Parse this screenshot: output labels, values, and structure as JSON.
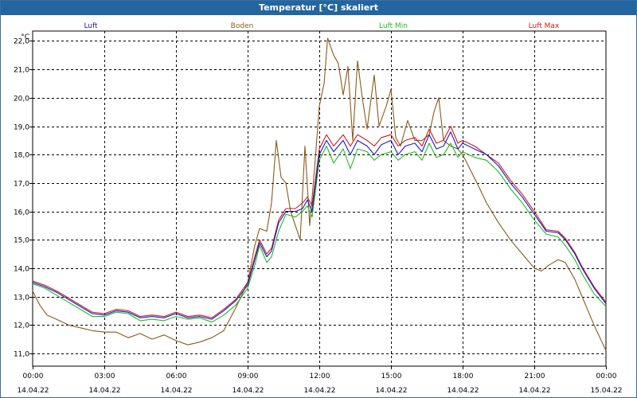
{
  "window": {
    "title": "Temperatur [°C] skaliert"
  },
  "chart_data": {
    "type": "line",
    "title": "Temperatur [°C] skaliert",
    "ylabel": "°C",
    "xlabel": "",
    "ylim": [
      10.55,
      22.35
    ],
    "grid": true,
    "legend_placement": "top",
    "y_ticks": [
      "11,0",
      "12,0",
      "13,0",
      "14,0",
      "15,0",
      "16,0",
      "17,0",
      "18,0",
      "19,0",
      "20,0",
      "21,0",
      "22,0"
    ],
    "x_ticks": [
      {
        "time": "00:00",
        "date": "14.04.22",
        "hour": 0
      },
      {
        "time": "03:00",
        "date": "14.04.22",
        "hour": 3
      },
      {
        "time": "06:00",
        "date": "14.04.22",
        "hour": 6
      },
      {
        "time": "09:00",
        "date": "14.04.22",
        "hour": 9
      },
      {
        "time": "12:00",
        "date": "14.04.22",
        "hour": 12
      },
      {
        "time": "15:00",
        "date": "14.04.22",
        "hour": 15
      },
      {
        "time": "18:00",
        "date": "14.04.22",
        "hour": 18
      },
      {
        "time": "21:00",
        "date": "14.04.22",
        "hour": 21
      },
      {
        "time": "00:00",
        "date": "15.04.22",
        "hour": 24
      }
    ],
    "series": [
      {
        "name": "Luft",
        "color": "#1a1acc",
        "points": [
          [
            0,
            13.5
          ],
          [
            0.5,
            13.35
          ],
          [
            1,
            13.15
          ],
          [
            1.5,
            12.9
          ],
          [
            2,
            12.65
          ],
          [
            2.5,
            12.4
          ],
          [
            3,
            12.35
          ],
          [
            3.5,
            12.5
          ],
          [
            4,
            12.45
          ],
          [
            4.5,
            12.25
          ],
          [
            5,
            12.3
          ],
          [
            5.5,
            12.25
          ],
          [
            6,
            12.4
          ],
          [
            6.5,
            12.25
          ],
          [
            7,
            12.3
          ],
          [
            7.5,
            12.2
          ],
          [
            8,
            12.5
          ],
          [
            8.5,
            12.85
          ],
          [
            9,
            13.4
          ],
          [
            9.3,
            14.3
          ],
          [
            9.5,
            14.9
          ],
          [
            9.8,
            14.4
          ],
          [
            10,
            14.6
          ],
          [
            10.3,
            15.6
          ],
          [
            10.6,
            16.0
          ],
          [
            11,
            16.0
          ],
          [
            11.3,
            16.1
          ],
          [
            11.5,
            16.4
          ],
          [
            11.7,
            16.0
          ],
          [
            12,
            18.0
          ],
          [
            12.3,
            18.5
          ],
          [
            12.6,
            18.1
          ],
          [
            13,
            18.5
          ],
          [
            13.3,
            18.0
          ],
          [
            13.6,
            18.5
          ],
          [
            14,
            18.3
          ],
          [
            14.3,
            18.0
          ],
          [
            14.6,
            18.35
          ],
          [
            15,
            18.5
          ],
          [
            15.3,
            18.0
          ],
          [
            15.6,
            18.3
          ],
          [
            16,
            18.4
          ],
          [
            16.3,
            18.1
          ],
          [
            16.6,
            18.7
          ],
          [
            16.9,
            18.2
          ],
          [
            17.2,
            18.3
          ],
          [
            17.5,
            18.8
          ],
          [
            17.8,
            18.2
          ],
          [
            18,
            18.4
          ],
          [
            18.5,
            18.2
          ],
          [
            19,
            18.0
          ],
          [
            19.5,
            17.6
          ],
          [
            20,
            17.0
          ],
          [
            20.5,
            16.5
          ],
          [
            21,
            15.9
          ],
          [
            21.5,
            15.3
          ],
          [
            22,
            15.25
          ],
          [
            22.3,
            15.0
          ],
          [
            22.7,
            14.5
          ],
          [
            23,
            14.0
          ],
          [
            23.5,
            13.3
          ],
          [
            24,
            12.75
          ]
        ]
      },
      {
        "name": "Boden",
        "color": "#8b5a1a",
        "points": [
          [
            0,
            13.2
          ],
          [
            0.3,
            12.7
          ],
          [
            0.6,
            12.35
          ],
          [
            1,
            12.2
          ],
          [
            1.5,
            12.0
          ],
          [
            2,
            11.9
          ],
          [
            2.5,
            11.8
          ],
          [
            3,
            11.75
          ],
          [
            3.5,
            11.75
          ],
          [
            4,
            11.55
          ],
          [
            4.5,
            11.7
          ],
          [
            5,
            11.5
          ],
          [
            5.5,
            11.65
          ],
          [
            6,
            11.45
          ],
          [
            6.5,
            11.3
          ],
          [
            7,
            11.4
          ],
          [
            7.5,
            11.55
          ],
          [
            8,
            11.8
          ],
          [
            8.5,
            12.6
          ],
          [
            9,
            13.5
          ],
          [
            9.3,
            14.8
          ],
          [
            9.5,
            15.4
          ],
          [
            9.8,
            15.3
          ],
          [
            10,
            16.3
          ],
          [
            10.2,
            18.5
          ],
          [
            10.4,
            17.2
          ],
          [
            10.6,
            17.0
          ],
          [
            10.8,
            16.0
          ],
          [
            11,
            15.5
          ],
          [
            11.2,
            15.0
          ],
          [
            11.4,
            18.3
          ],
          [
            11.6,
            15.5
          ],
          [
            11.8,
            17.5
          ],
          [
            12,
            19.7
          ],
          [
            12.2,
            20.5
          ],
          [
            12.35,
            22.1
          ],
          [
            12.6,
            21.5
          ],
          [
            12.8,
            21.2
          ],
          [
            13,
            20.1
          ],
          [
            13.2,
            21.1
          ],
          [
            13.4,
            18.5
          ],
          [
            13.6,
            21.3
          ],
          [
            13.8,
            20.0
          ],
          [
            14,
            18.9
          ],
          [
            14.3,
            20.8
          ],
          [
            14.5,
            19.0
          ],
          [
            14.8,
            19.7
          ],
          [
            15,
            20.3
          ],
          [
            15.2,
            18.6
          ],
          [
            15.4,
            18.3
          ],
          [
            15.7,
            19.2
          ],
          [
            16,
            18.5
          ],
          [
            16.3,
            18.5
          ],
          [
            16.6,
            18.7
          ],
          [
            16.8,
            19.5
          ],
          [
            17,
            20.0
          ],
          [
            17.2,
            18.5
          ],
          [
            17.5,
            18.3
          ],
          [
            17.8,
            18.2
          ],
          [
            18,
            18.0
          ],
          [
            18.3,
            17.5
          ],
          [
            18.6,
            17.0
          ],
          [
            19,
            16.3
          ],
          [
            19.5,
            15.6
          ],
          [
            20,
            15.0
          ],
          [
            20.5,
            14.5
          ],
          [
            21,
            14.0
          ],
          [
            21.3,
            13.9
          ],
          [
            21.6,
            14.1
          ],
          [
            22,
            14.3
          ],
          [
            22.3,
            14.2
          ],
          [
            22.7,
            13.6
          ],
          [
            23,
            13.0
          ],
          [
            23.5,
            12.0
          ],
          [
            24,
            11.1
          ]
        ]
      },
      {
        "name": "Luft Min",
        "color": "#22bb22",
        "points": [
          [
            0,
            13.45
          ],
          [
            0.5,
            13.3
          ],
          [
            1,
            13.05
          ],
          [
            1.5,
            12.8
          ],
          [
            2,
            12.55
          ],
          [
            2.5,
            12.3
          ],
          [
            3,
            12.3
          ],
          [
            3.5,
            12.45
          ],
          [
            4,
            12.4
          ],
          [
            4.5,
            12.15
          ],
          [
            5,
            12.2
          ],
          [
            5.5,
            12.15
          ],
          [
            6,
            12.3
          ],
          [
            6.5,
            12.2
          ],
          [
            7,
            12.25
          ],
          [
            7.5,
            12.1
          ],
          [
            8,
            12.35
          ],
          [
            8.5,
            12.7
          ],
          [
            9,
            13.3
          ],
          [
            9.3,
            14.1
          ],
          [
            9.5,
            14.8
          ],
          [
            9.8,
            14.2
          ],
          [
            10,
            14.4
          ],
          [
            10.3,
            15.3
          ],
          [
            10.6,
            15.9
          ],
          [
            11,
            15.8
          ],
          [
            11.3,
            16.0
          ],
          [
            11.5,
            16.2
          ],
          [
            11.7,
            15.8
          ],
          [
            12,
            17.8
          ],
          [
            12.3,
            18.3
          ],
          [
            12.6,
            17.7
          ],
          [
            13,
            18.2
          ],
          [
            13.3,
            17.5
          ],
          [
            13.6,
            18.2
          ],
          [
            14,
            18.1
          ],
          [
            14.3,
            17.8
          ],
          [
            14.6,
            18.0
          ],
          [
            15,
            18.1
          ],
          [
            15.3,
            17.8
          ],
          [
            15.6,
            18.0
          ],
          [
            16,
            18.1
          ],
          [
            16.3,
            17.8
          ],
          [
            16.6,
            18.4
          ],
          [
            16.9,
            17.9
          ],
          [
            17.2,
            18.0
          ],
          [
            17.5,
            18.4
          ],
          [
            17.8,
            17.9
          ],
          [
            18,
            18.1
          ],
          [
            18.5,
            17.9
          ],
          [
            19,
            17.8
          ],
          [
            19.5,
            17.4
          ],
          [
            20,
            16.8
          ],
          [
            20.5,
            16.3
          ],
          [
            21,
            15.7
          ],
          [
            21.5,
            15.2
          ],
          [
            22,
            15.1
          ],
          [
            22.3,
            14.8
          ],
          [
            22.7,
            14.3
          ],
          [
            23,
            13.8
          ],
          [
            23.5,
            13.1
          ],
          [
            24,
            12.65
          ]
        ]
      },
      {
        "name": "Luft Max",
        "color": "#cc1a1a",
        "points": [
          [
            0,
            13.55
          ],
          [
            0.5,
            13.4
          ],
          [
            1,
            13.2
          ],
          [
            1.5,
            12.95
          ],
          [
            2,
            12.7
          ],
          [
            2.5,
            12.45
          ],
          [
            3,
            12.4
          ],
          [
            3.5,
            12.55
          ],
          [
            4,
            12.5
          ],
          [
            4.5,
            12.3
          ],
          [
            5,
            12.35
          ],
          [
            5.5,
            12.3
          ],
          [
            6,
            12.45
          ],
          [
            6.5,
            12.3
          ],
          [
            7,
            12.35
          ],
          [
            7.5,
            12.25
          ],
          [
            8,
            12.55
          ],
          [
            8.5,
            12.9
          ],
          [
            9,
            13.5
          ],
          [
            9.3,
            14.4
          ],
          [
            9.5,
            15.0
          ],
          [
            9.8,
            14.5
          ],
          [
            10,
            14.7
          ],
          [
            10.3,
            15.7
          ],
          [
            10.6,
            16.1
          ],
          [
            11,
            16.1
          ],
          [
            11.3,
            16.3
          ],
          [
            11.5,
            16.5
          ],
          [
            11.7,
            16.2
          ],
          [
            12,
            18.2
          ],
          [
            12.3,
            18.7
          ],
          [
            12.6,
            18.3
          ],
          [
            13,
            18.7
          ],
          [
            13.3,
            18.3
          ],
          [
            13.6,
            18.7
          ],
          [
            14,
            18.5
          ],
          [
            14.3,
            18.3
          ],
          [
            14.6,
            18.6
          ],
          [
            15,
            18.7
          ],
          [
            15.3,
            18.3
          ],
          [
            15.6,
            18.5
          ],
          [
            16,
            18.6
          ],
          [
            16.3,
            18.3
          ],
          [
            16.6,
            18.9
          ],
          [
            16.9,
            18.4
          ],
          [
            17.2,
            18.5
          ],
          [
            17.5,
            19.0
          ],
          [
            17.8,
            18.4
          ],
          [
            18,
            18.5
          ],
          [
            18.5,
            18.3
          ],
          [
            19,
            18.0
          ],
          [
            19.5,
            17.7
          ],
          [
            20,
            17.1
          ],
          [
            20.5,
            16.6
          ],
          [
            21,
            16.0
          ],
          [
            21.5,
            15.35
          ],
          [
            22,
            15.3
          ],
          [
            22.3,
            15.05
          ],
          [
            22.7,
            14.55
          ],
          [
            23,
            14.05
          ],
          [
            23.5,
            13.35
          ],
          [
            24,
            12.8
          ]
        ]
      }
    ]
  }
}
